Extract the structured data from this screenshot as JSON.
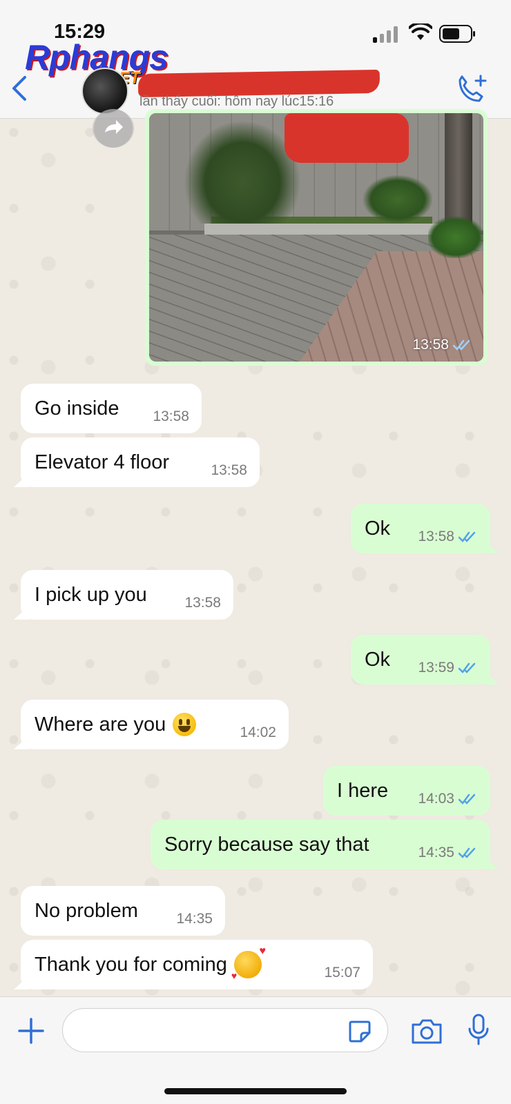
{
  "status_bar": {
    "time": "15:29"
  },
  "watermark": {
    "main": "Rphangs",
    "sub": ".NET"
  },
  "header": {
    "last_seen": "lần thấy cuối: hôm nay lúc15:16"
  },
  "image_message": {
    "time": "13:58",
    "read": true
  },
  "messages": [
    {
      "direction": "in",
      "text": "Go inside",
      "time": "13:58"
    },
    {
      "direction": "in",
      "text": "Elevator 4 floor",
      "time": "13:58"
    },
    {
      "direction": "out",
      "text": "Ok",
      "time": "13:58",
      "read": true
    },
    {
      "direction": "in",
      "text": "I pick up you",
      "time": "13:58"
    },
    {
      "direction": "out",
      "text": "Ok",
      "time": "13:59",
      "read": true
    },
    {
      "direction": "in",
      "text": "Where are you",
      "emoji": "grinning-face",
      "time": "14:02"
    },
    {
      "direction": "out",
      "text": "I here",
      "time": "14:03",
      "read": true
    },
    {
      "direction": "out",
      "text": "Sorry because say that",
      "time": "14:35",
      "read": true
    },
    {
      "direction": "in",
      "text": "No problem",
      "time": "14:35"
    },
    {
      "direction": "in",
      "text": "Thank you for coming",
      "emoji": "smiling-face-with-hearts",
      "time": "15:07"
    }
  ],
  "input": {
    "value": "",
    "placeholder": ""
  },
  "colors": {
    "accent": "#2f6fd6",
    "outgoing_bubble": "#d9fdd3",
    "incoming_bubble": "#ffffff",
    "read_ticks": "#4fa3e8",
    "redaction": "#d9342b"
  }
}
